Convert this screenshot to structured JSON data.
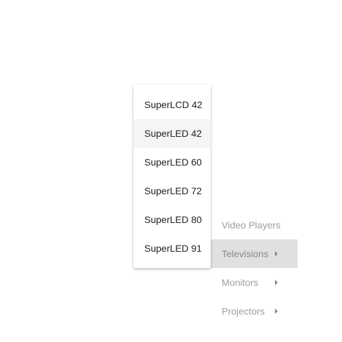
{
  "parent_menu": {
    "items": [
      {
        "label": "Video Players",
        "has_submenu": false,
        "active": false
      },
      {
        "label": "Televisions",
        "has_submenu": true,
        "active": true
      },
      {
        "label": "Monitors",
        "has_submenu": true,
        "active": false
      },
      {
        "label": "Projectors",
        "has_submenu": true,
        "active": false
      }
    ]
  },
  "submenu": {
    "items": [
      {
        "label": "SuperLCD 42",
        "hover": false
      },
      {
        "label": "SuperLED 42",
        "hover": true
      },
      {
        "label": "SuperLED 60",
        "hover": false
      },
      {
        "label": "SuperLED 72",
        "hover": false
      },
      {
        "label": "SuperLED 80",
        "hover": false
      },
      {
        "label": "SuperLED 91",
        "hover": false
      }
    ]
  },
  "icons": {
    "submenu_arrow": "caret-right-icon"
  },
  "colors": {
    "active_background": "#e0e0e0",
    "hover_background": "#f5f5f5",
    "muted_text": "#9e9e9e",
    "primary_text": "#212121"
  }
}
